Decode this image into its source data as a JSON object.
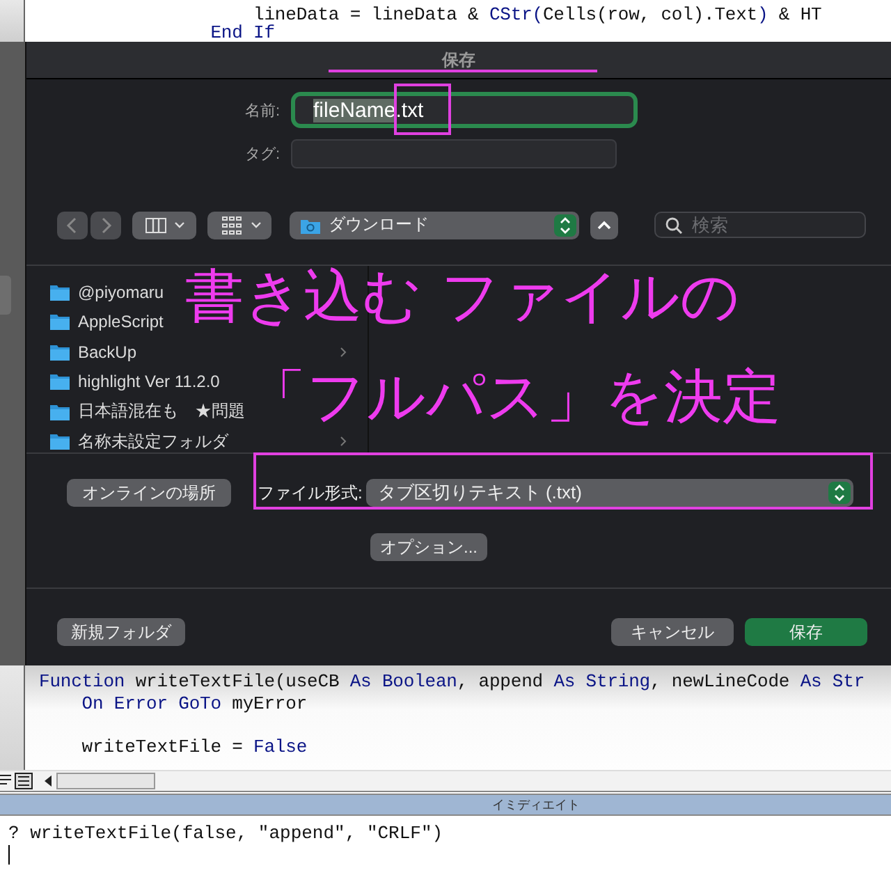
{
  "editor_top": {
    "lines": [
      {
        "kind": "code",
        "tokens": [
          {
            "kind": "plain",
            "text": "                    lineData = lineData & "
          },
          {
            "kind": "keyword",
            "text": "CStr("
          },
          {
            "kind": "plain",
            "text": "Cells(row, col).Text"
          },
          {
            "kind": "keyword",
            "text": ")"
          },
          {
            "kind": "plain",
            "text": " & HT"
          }
        ]
      },
      {
        "kind": "code",
        "tokens": [
          {
            "kind": "keyword",
            "text": "                End If"
          }
        ]
      }
    ]
  },
  "save_dialog": {
    "title": "保存",
    "name_label": "名前:",
    "name_value": [
      {
        "text": "fileName",
        "selected": true
      },
      {
        "text": ".txt",
        "selected": false
      }
    ],
    "tag_label": "タグ:",
    "location": "ダウンロード",
    "search": {
      "placeholder": "検索"
    },
    "folders": [
      {
        "name": "@piyomaru"
      },
      {
        "name": "AppleScript"
      },
      {
        "name": "BackUp"
      },
      {
        "name": "highlight Ver 11.2.0"
      },
      {
        "name": "日本語混在も　★問題"
      },
      {
        "name": "名称未設定フォルダ"
      }
    ],
    "online_button": "オンラインの場所",
    "format_label": "ファイル形式:",
    "format_value": "タブ区切りテキスト (.txt)",
    "options_button": "オプション...",
    "new_folder_button": "新規フォルダ",
    "cancel_button": "キャンセル",
    "save_button": "保存"
  },
  "annotation": {
    "lines": [
      "書き込む ファイルの",
      "「フルパス」を決定"
    ]
  },
  "editor_bottom": {
    "lines": [
      {
        "kind": "code",
        "tokens": [
          {
            "kind": "keyword",
            "text": "Function"
          },
          {
            "kind": "plain",
            "text": " writeTextFile(useCB "
          },
          {
            "kind": "keyword",
            "text": "As Boolean"
          },
          {
            "kind": "plain",
            "text": ", append "
          },
          {
            "kind": "keyword",
            "text": "As String"
          },
          {
            "kind": "plain",
            "text": ", newLineCode "
          },
          {
            "kind": "keyword",
            "text": "As Str"
          }
        ]
      },
      {
        "kind": "code",
        "tokens": [
          {
            "kind": "keyword",
            "text": "    On Error GoTo"
          },
          {
            "kind": "plain",
            "text": " myError"
          }
        ]
      },
      {
        "kind": "blank"
      },
      {
        "kind": "code",
        "tokens": [
          {
            "kind": "plain",
            "text": "    writeTextFile = "
          },
          {
            "kind": "keyword",
            "text": "False"
          }
        ]
      }
    ]
  },
  "immediate": {
    "title": "イミディエイト",
    "lines": [
      "? writeTextFile(false, \"append\", \"CRLF\")"
    ]
  }
}
